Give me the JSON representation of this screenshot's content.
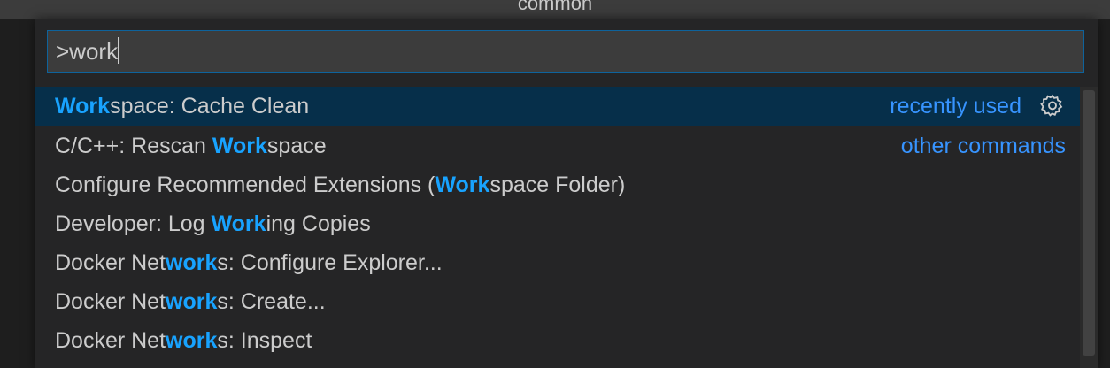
{
  "window": {
    "title": "common"
  },
  "palette": {
    "input_value": ">work",
    "items": [
      {
        "pre": "",
        "match": "Work",
        "post": "space: Cache Clean",
        "tag": "recently used",
        "has_gear": true,
        "selected": true
      },
      {
        "pre": "C/C++: Rescan ",
        "match": "Work",
        "post": "space",
        "tag": "other commands",
        "has_gear": false
      },
      {
        "pre": "Configure Recommended Extensions (",
        "match": "Work",
        "post": "space Folder)",
        "tag": "",
        "has_gear": false
      },
      {
        "pre": "Developer: Log ",
        "match": "Work",
        "post": "ing Copies",
        "tag": "",
        "has_gear": false
      },
      {
        "pre": "Docker Net",
        "match": "work",
        "post": "s: Configure Explorer...",
        "tag": "",
        "has_gear": false
      },
      {
        "pre": "Docker Net",
        "match": "work",
        "post": "s: Create...",
        "tag": "",
        "has_gear": false
      },
      {
        "pre": "Docker Net",
        "match": "work",
        "post": "s: Inspect",
        "tag": "",
        "has_gear": false
      }
    ]
  },
  "colors": {
    "accent": "#18a3ff",
    "selection": "#062f4a",
    "tag": "#3794ff"
  },
  "icons": {
    "configure": "gear-icon"
  }
}
